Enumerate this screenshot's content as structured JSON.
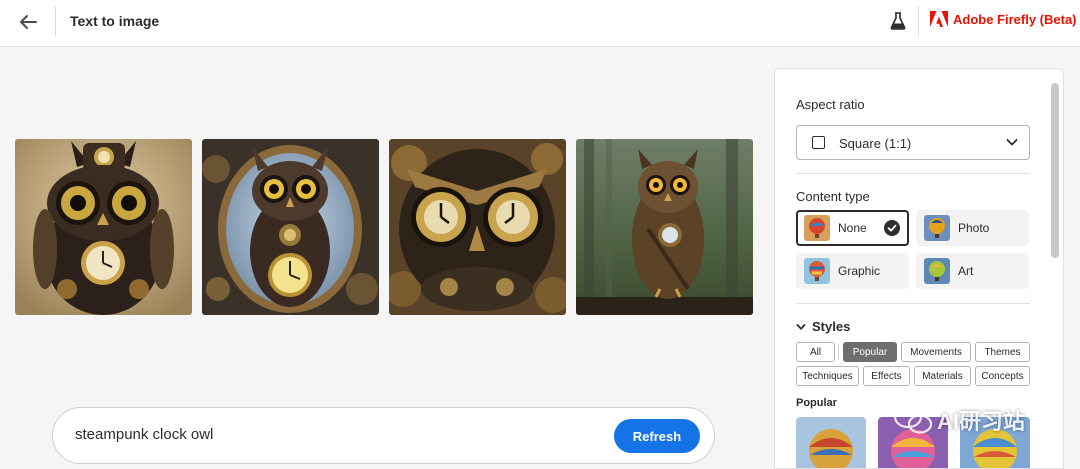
{
  "header": {
    "title": "Text to image",
    "brand": "Adobe Firefly (Beta)"
  },
  "icons": {
    "back": "arrow-left-icon",
    "labs": "flask-icon",
    "brand_logo": "adobe-logo-icon"
  },
  "colors": {
    "accent": "#1473e6",
    "brand": "#eb1000",
    "chip_active": "#6e6e6e"
  },
  "gallery": {
    "images": [
      {
        "label": "steampunk owl with pocket watch hat on brown background"
      },
      {
        "label": "steampunk owl with clock face in gear frame on blue background"
      },
      {
        "label": "close-up steampunk owl with clock-face eyes among gears"
      },
      {
        "label": "steampunk owl perched on branch in forest"
      }
    ]
  },
  "prompt": {
    "value": "steampunk clock owl",
    "refresh_label": "Refresh"
  },
  "panel": {
    "aspect_ratio": {
      "label": "Aspect ratio",
      "value": "Square (1:1)"
    },
    "content_type": {
      "label": "Content type",
      "options": [
        {
          "label": "None",
          "selected": true
        },
        {
          "label": "Photo",
          "selected": false
        },
        {
          "label": "Graphic",
          "selected": false
        },
        {
          "label": "Art",
          "selected": false
        }
      ]
    },
    "styles": {
      "label": "Styles",
      "filters": [
        "All",
        "Popular",
        "Movements",
        "Themes",
        "Techniques",
        "Effects",
        "Materials",
        "Concepts"
      ],
      "active_filter": "Popular"
    },
    "popular": {
      "label": "Popular"
    }
  },
  "watermark": {
    "text": "AI研习站"
  }
}
